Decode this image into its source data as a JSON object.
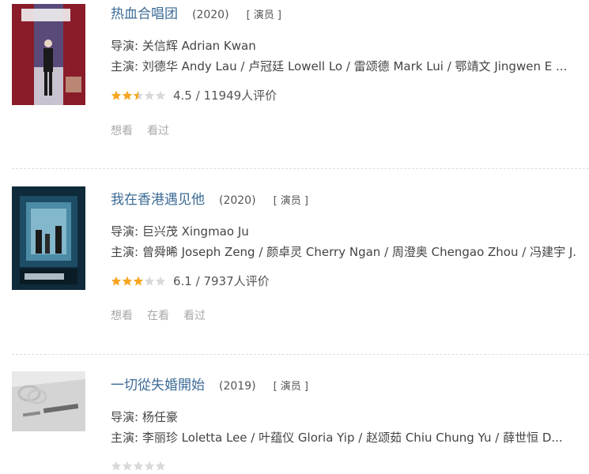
{
  "items": [
    {
      "title": "热血合唱团",
      "year": "(2020)",
      "role": "[ 演员 ]",
      "director_label": "导演:",
      "director": " 关信辉 Adrian Kwan",
      "cast_label": "主演:",
      "cast": " 刘德华 Andy Lau / 卢冠廷 Lowell Lo / 雷颂德 Mark Lui / 鄂靖文 Jingwen E ...",
      "rating_stars": 2.5,
      "rating_text": "4.5 / 11949人评价",
      "actions": [
        "想看",
        "看过"
      ]
    },
    {
      "title": "我在香港遇见他",
      "year": "(2020)",
      "role": "[ 演员 ]",
      "director_label": "导演:",
      "director": " 巨兴茂 Xingmao Ju",
      "cast_label": "主演:",
      "cast": " 曾舜晞 Joseph Zeng / 颜卓灵 Cherry Ngan / 周澄奥 Chengao Zhou / 冯建宇 J...",
      "rating_stars": 3,
      "rating_text": "6.1 / 7937人评价",
      "actions": [
        "想看",
        "在看",
        "看过"
      ]
    },
    {
      "title": "一切從失婚開始",
      "year": "(2019)",
      "role": "[ 演员 ]",
      "director_label": "导演:",
      "director": " 杨任豪",
      "cast_label": "主演:",
      "cast": " 李丽珍 Loletta Lee / 叶蕴仪 Gloria Yip / 赵颂茹 Chiu Chung Yu / 薛世恒 D...",
      "rating_stars": 0,
      "rating_text": "",
      "actions": []
    }
  ],
  "colors": {
    "title": "#3b6b96",
    "star_on": "#f5a623",
    "star_off": "#d9d9d9"
  }
}
